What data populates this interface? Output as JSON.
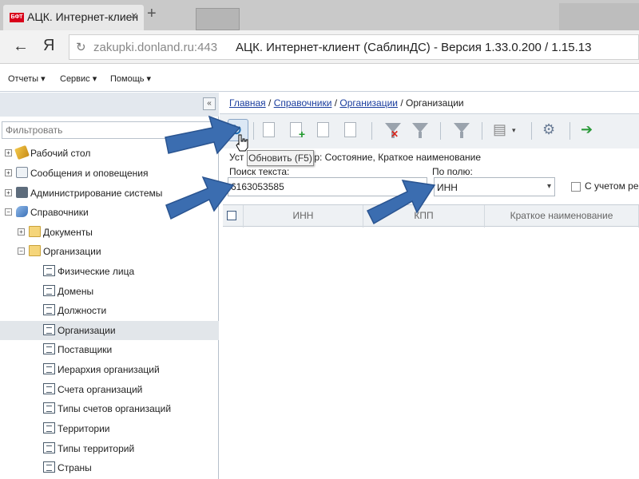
{
  "browser": {
    "tab_title": "АЦК. Интернет-клиен",
    "tab_close": "×",
    "new_tab": "+",
    "favicon_text": "БФТ",
    "back": "←",
    "yandex": "Я",
    "reload_glyph": "↻",
    "url": "zakupki.donland.ru:443",
    "page_title": "АЦК. Интернет-клиент (СаблинДС) - Версия 1.33.0.200 / 1.15.13"
  },
  "menu": {
    "items": [
      "Отчеты ▾",
      "Сервис ▾",
      "Помощь ▾"
    ]
  },
  "sidebar": {
    "collapse": "«",
    "filter_placeholder": "Фильтровать",
    "items": [
      {
        "label": "Рабочий стол",
        "icon": "desktop-icon"
      },
      {
        "label": "Сообщения и оповещения",
        "icon": "mail-icon"
      },
      {
        "label": "Администрирование системы",
        "icon": "admin-icon"
      },
      {
        "label": "Справочники",
        "icon": "book-icon"
      },
      {
        "label": "Документы",
        "icon": "folder-icon"
      },
      {
        "label": "Организации",
        "icon": "folder-icon"
      },
      {
        "label": "Физические лица",
        "icon": "document-icon"
      },
      {
        "label": "Домены",
        "icon": "document-icon"
      },
      {
        "label": "Должности",
        "icon": "document-icon"
      },
      {
        "label": "Организации",
        "icon": "document-icon",
        "selected": true
      },
      {
        "label": "Поставщики",
        "icon": "document-icon"
      },
      {
        "label": "Иерархия организаций",
        "icon": "document-icon"
      },
      {
        "label": "Счета организаций",
        "icon": "document-icon"
      },
      {
        "label": "Типы счетов организаций",
        "icon": "document-icon"
      },
      {
        "label": "Территории",
        "icon": "document-icon"
      },
      {
        "label": "Типы территорий",
        "icon": "document-icon"
      },
      {
        "label": "Страны",
        "icon": "document-icon"
      }
    ],
    "expand_symbols": {
      "collapsed": "+",
      "expanded": "−"
    }
  },
  "breadcrumb": {
    "home": "Главная",
    "sep": " / ",
    "refs": "Справочники",
    "orgs": "Организации",
    "current": "Организации"
  },
  "toolbar": {
    "refresh_glyph": "↻",
    "tooltip": "Обновить (F5)",
    "settings_glyph": "⚙",
    "exit_glyph": "➔"
  },
  "filter": {
    "status_prefix": "Уст",
    "status_suffix": "р: Состояние, Краткое наименование",
    "search_label": "Поиск текста:",
    "search_value": "6163053585",
    "field_label": "По полю:",
    "field_value": "ИНН",
    "field_arrow": "▾",
    "case_label": "С учетом ре"
  },
  "grid": {
    "columns": [
      "ИНН",
      "КПП",
      "Краткое наименование"
    ]
  },
  "colors": {
    "arrow_fill": "#3b6db0",
    "link": "#1a3d9e",
    "selected_row": "#e2e6ea"
  }
}
